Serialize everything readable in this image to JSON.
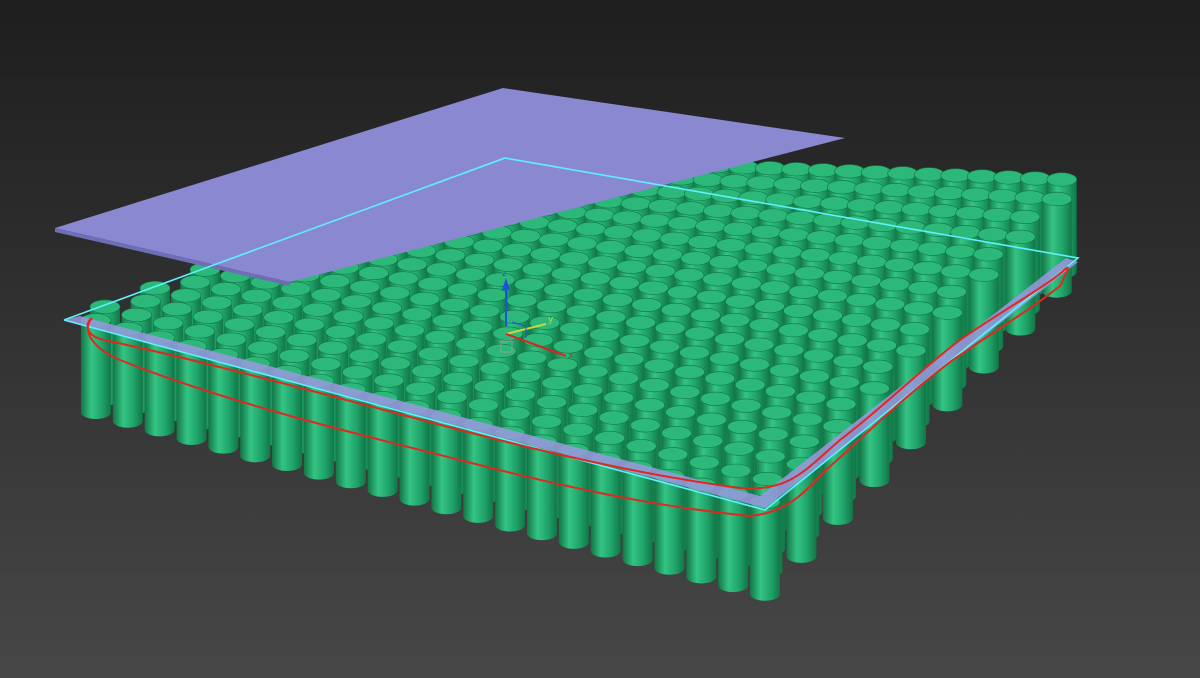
{
  "viewport": {
    "background_top": "#1e1e1e",
    "background_bottom": "#474747"
  },
  "model": {
    "cell_color": "#1fa36a",
    "cell_color_light": "#34c483",
    "cell_color_dark": "#127646",
    "cell_top_color": "#2bb878",
    "top_plate_color": "#8a88d0",
    "top_plate_edge": "#6f6db6",
    "bottom_plate_color": "#9b98e0",
    "bottom_plate_edge": "#c3d6f5",
    "selection_color": "#5ff0ff",
    "annotation_color": "#e0281e"
  },
  "gizmo": {
    "x_label": "x",
    "y_label": "y",
    "z_label": "z",
    "x_color": "#e02020",
    "y_color": "#c8d83a",
    "z_color": "#2050e0",
    "box_color": "#9a9a9a"
  }
}
